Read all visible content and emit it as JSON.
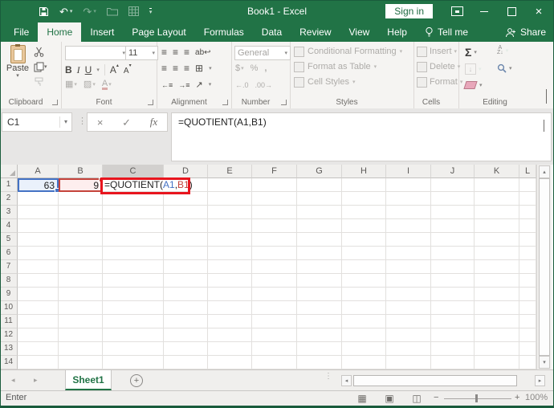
{
  "titlebar": {
    "title": "Book1 - Excel",
    "sign_in": "Sign in"
  },
  "tabs": [
    "File",
    "Home",
    "Insert",
    "Page Layout",
    "Formulas",
    "Data",
    "Review",
    "View",
    "Help"
  ],
  "tell_me": "Tell me",
  "share": "Share",
  "ribbon": {
    "groups": [
      "Clipboard",
      "Font",
      "Alignment",
      "Number",
      "Styles",
      "Cells",
      "Editing"
    ],
    "paste": "Paste",
    "font_size": "11",
    "bold": "B",
    "italic": "I",
    "underline": "U",
    "number_format": "General",
    "autosum": "Σ",
    "styles_buttons": [
      "Conditional Formatting",
      "Format as Table",
      "Cell Styles"
    ],
    "cells_buttons": [
      "Insert",
      "Delete",
      "Format"
    ]
  },
  "formula_bar": {
    "name_box": "C1",
    "fx": "fx",
    "formula": "=QUOTIENT(A1,B1)"
  },
  "grid": {
    "columns": [
      "A",
      "B",
      "C",
      "D",
      "E",
      "F",
      "G",
      "H",
      "I",
      "J",
      "K",
      "L"
    ],
    "rows": [
      "1",
      "2",
      "3",
      "4",
      "5",
      "6",
      "7",
      "8",
      "9",
      "10",
      "11",
      "12",
      "13",
      "14"
    ],
    "cells": {
      "A1": "63",
      "B1": "9"
    },
    "active_cell": "C1",
    "selected_column": "C",
    "c1_formula": {
      "prefix": "=QUOTIENT(",
      "ref1": "A1",
      "comma": ",",
      "ref2": "B1",
      "suffix": ")"
    }
  },
  "sheet_bar": {
    "active_tab": "Sheet1"
  },
  "status_bar": {
    "mode": "Enter",
    "zoom": "100%"
  },
  "colors": {
    "excel_green": "#217346",
    "ref_blue": "#4472c4",
    "ref_blue_fill": "#eaf1fb",
    "ref_red": "#c5443c",
    "ref_red_fill": "#fdeeee",
    "annotation_red": "#e8151e"
  }
}
